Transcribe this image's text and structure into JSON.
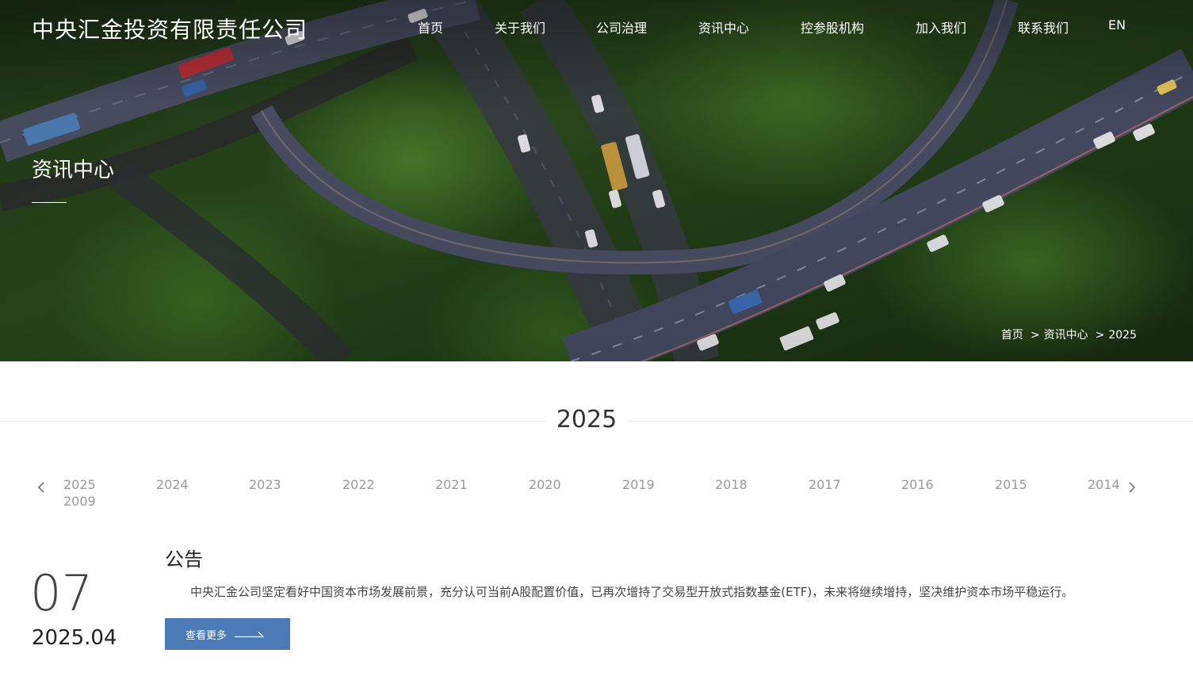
{
  "header": {
    "logo": "中央汇金投资有限责任公司",
    "nav": [
      {
        "label": "首页"
      },
      {
        "label": "关于我们"
      },
      {
        "label": "公司治理"
      },
      {
        "label": "资讯中心"
      },
      {
        "label": "控参股机构"
      },
      {
        "label": "加入我们"
      },
      {
        "label": "联系我们"
      },
      {
        "label": "EN"
      }
    ]
  },
  "hero": {
    "title": "资讯中心",
    "breadcrumb": [
      "首页",
      "资讯中心",
      "2025"
    ],
    "breadcrumb_separator": ">"
  },
  "year_section": {
    "heading": "2025",
    "years": [
      "2025",
      "2024",
      "2023",
      "2022",
      "2021",
      "2020",
      "2019",
      "2018",
      "2017",
      "2016",
      "2015",
      "2014",
      "2009"
    ],
    "prev_icon": "chevron-left-icon",
    "next_icon": "chevron-right-icon"
  },
  "news": {
    "day": "07",
    "month": "2025.04",
    "title": "公告",
    "summary": "中央汇金公司坚定看好中国资本市场发展前景，充分认可当前A股配置价值，已再次增持了交易型开放式指数基金(ETF)，未来将继续增持，坚决维护资本市场平稳运行。",
    "more_label": "查看更多",
    "more_icon": "arrow-right-icon"
  },
  "colors": {
    "button_bg": "#4a7bb7",
    "year_inactive": "#999999",
    "divider": "#e6e6e6"
  }
}
